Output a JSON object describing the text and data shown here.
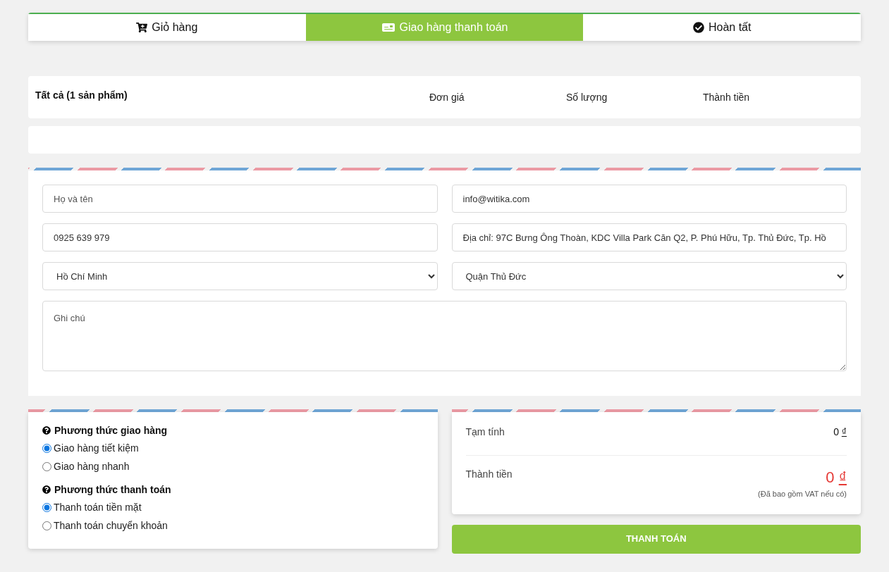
{
  "steps": [
    {
      "label": "Giỏ hàng",
      "kind": "cart",
      "selected": false
    },
    {
      "label": "Giao hàng thanh toán",
      "kind": "shipping",
      "selected": true
    },
    {
      "label": "Hoàn tất",
      "kind": "done",
      "selected": false
    }
  ],
  "cart_header": {
    "all": "Tất cả (1 sản phẩm)",
    "columns": [
      "Đơn giá",
      "Số lượng",
      "Thành tiền"
    ]
  },
  "form": {
    "name": {
      "placeholder": "Họ và tên"
    },
    "email": {
      "value": "info@witika.com"
    },
    "phone": {
      "value": "0925 639 979"
    },
    "address": {
      "value": "Địa chỉ: 97C Bưng Ông Thoàn, KDC Villa Park Căn Q2, P. Phú Hữu, Tp. Thủ Đức, Tp. Hồ"
    },
    "city": {
      "value": "Hồ Chí Minh"
    },
    "district": {
      "value": "Quận Thủ Đức"
    },
    "note": {
      "placeholder": "Ghi chú"
    }
  },
  "options": [
    {
      "title": "Phương thức giao hàng",
      "choices": [
        {
          "label": "Giao hàng tiết kiệm",
          "selected": true
        },
        {
          "label": "Giao hàng nhanh",
          "selected": false
        }
      ]
    },
    {
      "title": "Phương thức thanh toán",
      "choices": [
        {
          "label": "Thanh toán tiền mặt",
          "selected": true
        },
        {
          "label": "Thanh toán chuyển khoản",
          "selected": false
        }
      ]
    }
  ],
  "summary": {
    "subtotal_label": "Tạm tính",
    "subtotal_amount": "0",
    "subtotal_currency": "₫",
    "total_label": "Thành tiền",
    "total_amount": "0",
    "total_currency": "₫",
    "vat_note": "(Đã bao gồm VAT nếu có)"
  },
  "pay_button": "THANH TOÁN"
}
